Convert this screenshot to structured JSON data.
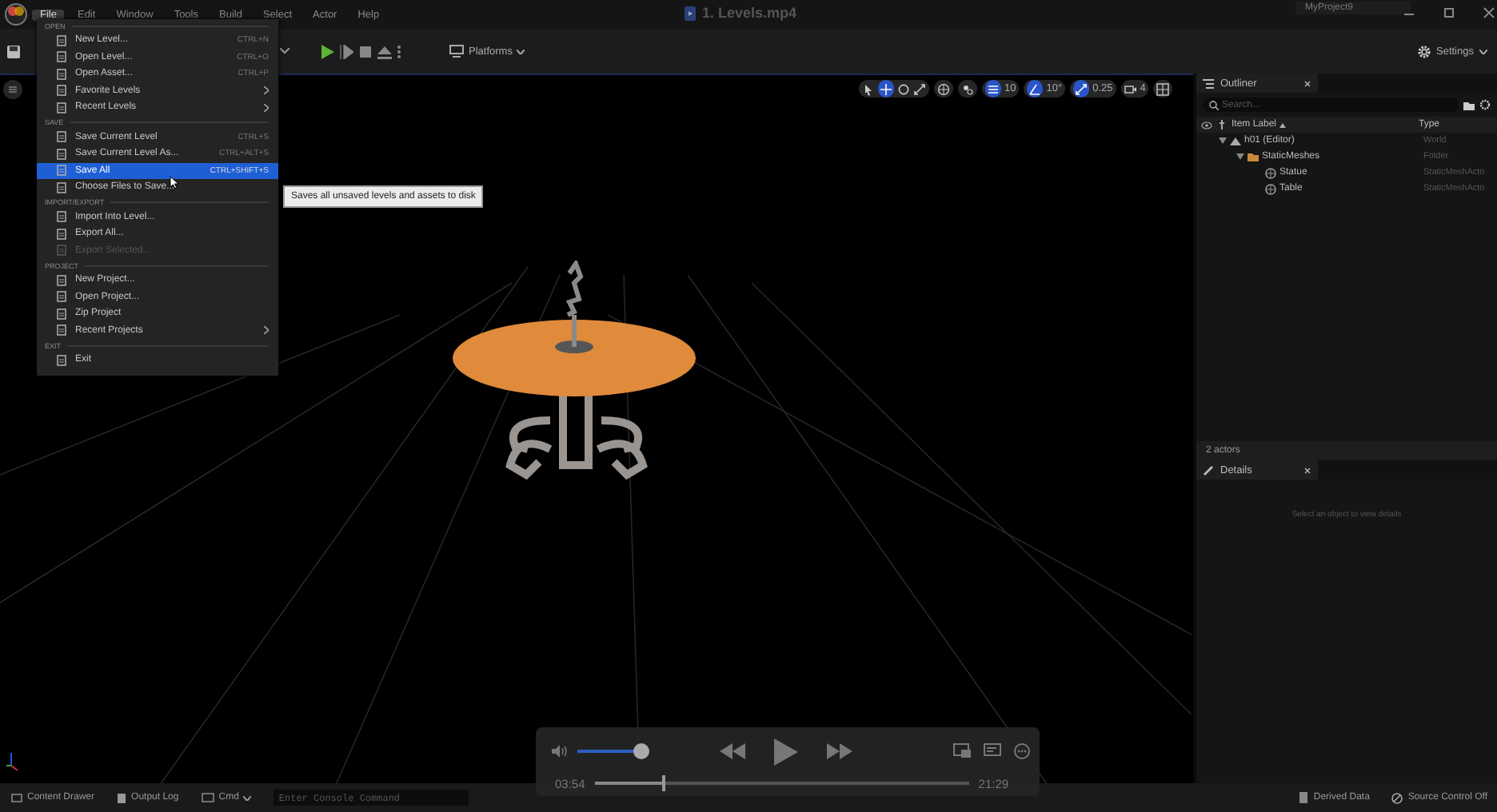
{
  "title_bar": {
    "menu": [
      {
        "label": "File",
        "selected": true
      },
      {
        "label": "Edit",
        "selected": false
      },
      {
        "label": "Window",
        "selected": false
      },
      {
        "label": "Tools",
        "selected": false
      },
      {
        "label": "Build",
        "selected": false
      },
      {
        "label": "Select",
        "selected": false
      },
      {
        "label": "Actor",
        "selected": false
      },
      {
        "label": "Help",
        "selected": false
      }
    ],
    "title": "1. Levels.mp4",
    "project": "MyProject9"
  },
  "toolbar": {
    "platforms": "Platforms",
    "settings": "Settings"
  },
  "viewport_toolbar": {
    "grid_snap": "10",
    "angle_snap": "10°",
    "scale_snap": "0.25",
    "camera_speed": "4"
  },
  "file_menu": {
    "sections": [
      {
        "heading": "OPEN",
        "items": [
          {
            "label": "New Level...",
            "shortcut": "CTRL+N",
            "submenu": false,
            "disabled": false,
            "selected": false
          },
          {
            "label": "Open Level...",
            "shortcut": "CTRL+O",
            "submenu": false,
            "disabled": false,
            "selected": false
          },
          {
            "label": "Open Asset...",
            "shortcut": "CTRL+P",
            "submenu": false,
            "disabled": false,
            "selected": false
          },
          {
            "label": "Favorite Levels",
            "submenu": true,
            "disabled": false,
            "selected": false
          },
          {
            "label": "Recent Levels",
            "submenu": true,
            "disabled": false,
            "selected": false
          }
        ]
      },
      {
        "heading": "SAVE",
        "items": [
          {
            "label": "Save Current Level",
            "shortcut": "CTRL+S",
            "submenu": false,
            "disabled": false,
            "selected": false
          },
          {
            "label": "Save Current Level As...",
            "shortcut": "CTRL+ALT+S",
            "submenu": false,
            "disabled": false,
            "selected": false
          },
          {
            "label": "Save All",
            "shortcut": "CTRL+SHIFT+S",
            "submenu": false,
            "disabled": false,
            "selected": true
          },
          {
            "label": "Choose Files to Save...",
            "submenu": false,
            "disabled": false,
            "selected": false
          }
        ]
      },
      {
        "heading": "IMPORT/EXPORT",
        "items": [
          {
            "label": "Import Into Level...",
            "submenu": false,
            "disabled": false,
            "selected": false
          },
          {
            "label": "Export All...",
            "submenu": false,
            "disabled": false,
            "selected": false
          },
          {
            "label": "Export Selected...",
            "submenu": false,
            "disabled": true,
            "selected": false
          }
        ]
      },
      {
        "heading": "PROJECT",
        "items": [
          {
            "label": "New Project...",
            "submenu": false,
            "disabled": false,
            "selected": false
          },
          {
            "label": "Open Project...",
            "submenu": false,
            "disabled": false,
            "selected": false
          },
          {
            "label": "Zip Project",
            "submenu": false,
            "disabled": false,
            "selected": false
          },
          {
            "label": "Recent Projects",
            "submenu": true,
            "disabled": false,
            "selected": false
          }
        ]
      },
      {
        "heading": "EXIT",
        "items": [
          {
            "label": "Exit",
            "submenu": false,
            "disabled": false,
            "selected": false
          }
        ]
      }
    ]
  },
  "tooltip": "Saves all unsaved levels and assets to disk",
  "outliner": {
    "title": "Outliner",
    "search": {
      "placeholder": "Search..."
    },
    "columns": [
      "Item Label",
      "Type"
    ],
    "tree": [
      {
        "label": "h01 (Editor)",
        "type": "World",
        "expanded": true,
        "children": [
          {
            "label": "StaticMeshes",
            "type": "Folder",
            "expanded": true,
            "children": [
              {
                "label": "Statue",
                "type": "StaticMeshActo"
              },
              {
                "label": "Table",
                "type": "StaticMeshActo"
              }
            ]
          }
        ]
      }
    ],
    "footer": "2 actors"
  },
  "details": {
    "title": "Details",
    "message": "Select an object to view details"
  },
  "player": {
    "volume": {
      "level": 1.0
    },
    "current_time": "03:54",
    "duration": "21:29",
    "progress": {
      "level": 0.18
    }
  },
  "status_bar": {
    "content_drawer": "Content Drawer",
    "output_log": "Output Log",
    "cmd": "Cmd",
    "console": {
      "placeholder": "Enter Console Command"
    },
    "derived_data": "Derived Data",
    "source_control": "Source Control Off"
  }
}
